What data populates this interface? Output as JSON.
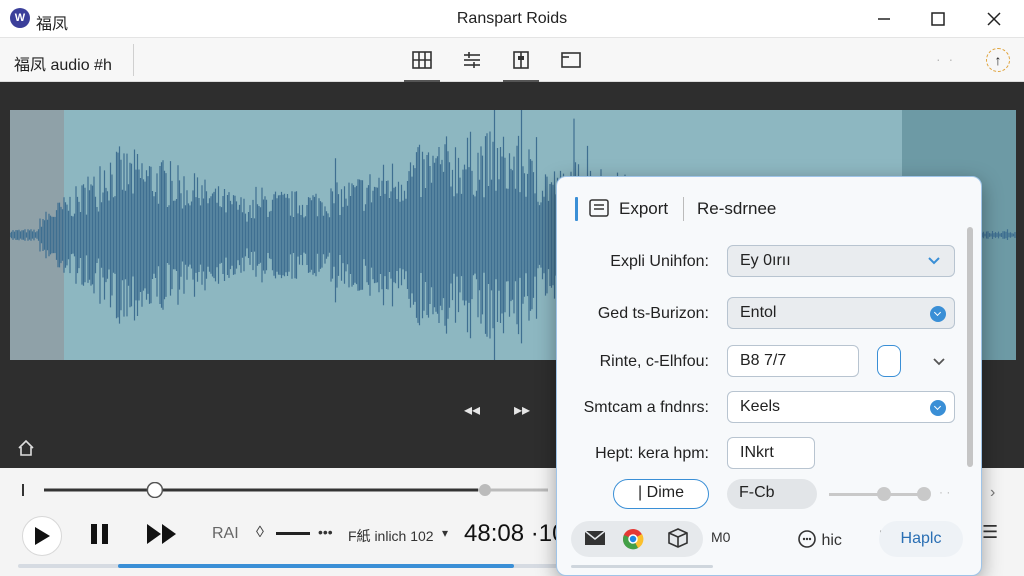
{
  "titlebar": {
    "app_logo_text": "W",
    "app_name": "福凤",
    "window_title": "Ranspart Roids"
  },
  "toolbar": {
    "doc_title": "福凤 audio #h",
    "dots": "· ·",
    "upload_glyph": "↑"
  },
  "waveform": {
    "fill_color": "#3f6f91",
    "background": "#8db7c1"
  },
  "transport": {
    "position": 0.22,
    "rate_label": "RAI",
    "vol_glyph": "◊",
    "vol_dots": "•••",
    "format_label": "F紙 inlich 102",
    "format_caret": "▾",
    "timecode": "48:08 ·10",
    "bottom_progress": 0.73,
    "right_chevron": "›",
    "list_glyph": "☰"
  },
  "dialog": {
    "tabs": [
      "Export",
      "Re-sdrnee"
    ],
    "rows": [
      {
        "label": "Expli Unihfon:",
        "value": "Ey 0ırıı"
      },
      {
        "label": "Ged ts-Burizon:",
        "value": "Entol"
      },
      {
        "label": "Rinte, c-Elhfou:",
        "value": "B8 7/7"
      },
      {
        "label": "Smtcam a fndnrs:",
        "value": "Keels"
      },
      {
        "label": "Hept: kera hpm:",
        "value": "INkrt"
      }
    ],
    "done_label": "| Dime",
    "fcb_label": "F-Cb",
    "slider_value": 0.55,
    "footer": {
      "m0_label": "M0",
      "hic_label": "hic",
      "apply_label": "Haplc"
    }
  },
  "colors": {
    "accent": "#3a8fd6",
    "wave": "#3f6f91"
  }
}
